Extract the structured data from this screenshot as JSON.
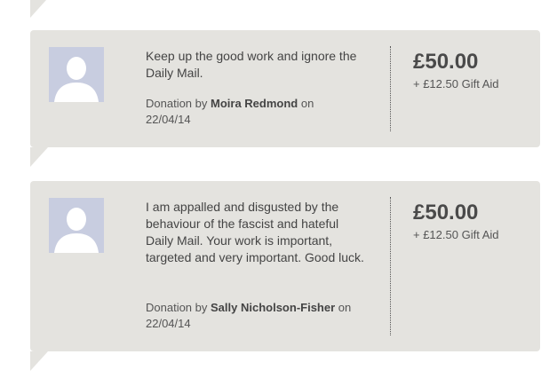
{
  "donations": [
    {
      "message": "Keep up the good work and ignore the Daily Mail.",
      "byline_prefix": "Donation by",
      "donor": "Moira Redmond",
      "byline_mid": "on",
      "date": "22/04/14",
      "amount": "£50.00",
      "gift_aid": "+ £12.50 Gift Aid",
      "avatar_icon": "default-user-silhouette-icon"
    },
    {
      "message": "I am appalled and disgusted by the behaviour of the fascist and hateful Daily Mail. Your work is important, targeted and very important. Good luck.",
      "byline_prefix": "Donation by",
      "donor": "Sally Nicholson-Fisher",
      "byline_mid": "on",
      "date": "22/04/14",
      "amount": "£50.00",
      "gift_aid": "+ £12.50 Gift Aid",
      "avatar_icon": "default-user-silhouette-icon"
    }
  ],
  "colors": {
    "card_bg": "#e4e3df",
    "avatar_bg": "#c8cde0",
    "text": "#444444"
  }
}
